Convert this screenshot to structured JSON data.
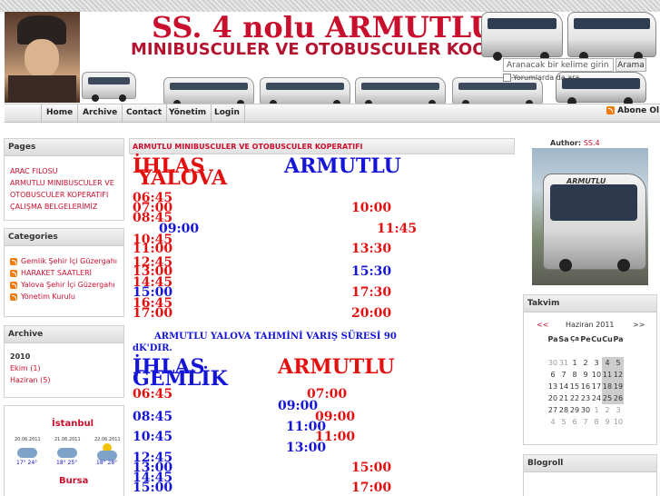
{
  "header": {
    "title": "SS. 4 nolu ARMUTLU",
    "subtitle": "MINIBUSCULER VE OTOBUSCULER  KOOP",
    "search_placeholder": "Aranacak bir kelime girin",
    "search_button": "Arama",
    "search_comments_label": "Yorumlarda da ara"
  },
  "nav": {
    "items": [
      "Home",
      "Archive",
      "Contact",
      "Yönetim",
      "Login"
    ],
    "subscribe": "Abone Ol"
  },
  "sidebar": {
    "pages_title": "Pages",
    "pages": [
      "ARAC FILOSU",
      "ARMUTLU MINIBUSCULER VE OTOBUSCULER KOPERATIFI",
      "ÇALIŞMA BELGELERİMİZ"
    ],
    "categories_title": "Categories",
    "categories": [
      "Gemlik Şehir İçi Güzergahı",
      "HARAKET SAATLERİ",
      "Yalova Şehir İçi Güzergahı",
      "Yönetim Kurulu"
    ],
    "archive_title": "Archive",
    "archive_year": "2010",
    "archive_items": [
      "Ekim (1)",
      "Haziran (5)"
    ],
    "weather_city1": "İstanbul",
    "weather_city2": "Bursa",
    "weather_days": [
      {
        "date": "20.06.2011",
        "temp": "17° 24°",
        "icon": "rain-cloud-icon"
      },
      {
        "date": "21.06.2011",
        "temp": "18° 25°",
        "icon": "rain-cloud-icon"
      },
      {
        "date": "22.06.2011",
        "temp": "18° 28°",
        "icon": "sun-cloud-icon"
      }
    ]
  },
  "post": {
    "title": "ARMUTLU MINIBUSCULER VE OTOBUSCULER KOPERATIFI",
    "yalova": {
      "col1": "İHLAS",
      "col1b": "YALOVA",
      "col2": "ARMUTLU",
      "left_times": [
        "06:45",
        "07:00",
        "08:45"
      ],
      "mid_time": "09:00",
      "left_times2": [
        "10:45",
        "11:00",
        "12:45",
        "13:00",
        "14:45"
      ],
      "left_blue": "15:00",
      "left_times3": [
        "16:45",
        "17:00"
      ],
      "right_times": [
        "10:00",
        "11:45",
        "13:30",
        "15:30",
        "17:30",
        "20:00"
      ],
      "note": "ARMUTLU YALOVA TAHMİNİ VARIŞ SÜRESİ  90 dK'DIR."
    },
    "gemlik": {
      "col1": "İHLAS",
      "col1b": "GEMLİK",
      "col2": "ARMUTLU",
      "left_red": "06:45",
      "right_a": "07:00",
      "mid_a": "09:00",
      "right_b": "09:00",
      "left_b": "08:45",
      "mid_b": "11:00",
      "right_c": "11:00",
      "left_c": "10:45",
      "mid_c": "13:00",
      "left_d": [
        "12:45",
        "13:00",
        "14:45",
        "15:00"
      ],
      "right_d": "15:00",
      "right_e": "17:00"
    }
  },
  "right": {
    "author_label": "Author:",
    "author_name": "SS.4",
    "bus_text": "ARMUTLU",
    "calendar_title": "Takvim",
    "calendar_month": "Haziran 2011",
    "calendar_prev": "<<",
    "calendar_next": ">>",
    "weekdays": [
      "Pa",
      "Sa",
      "Ça",
      "Pe",
      "Cu",
      "Cu",
      "Pa"
    ],
    "weeks": [
      [
        "30",
        "31",
        "1",
        "2",
        "3",
        "4",
        "5"
      ],
      [
        "6",
        "7",
        "8",
        "9",
        "10",
        "11",
        "12"
      ],
      [
        "13",
        "14",
        "15",
        "16",
        "17",
        "18",
        "19"
      ],
      [
        "20",
        "21",
        "22",
        "23",
        "24",
        "25",
        "26"
      ],
      [
        "27",
        "28",
        "29",
        "30",
        "1",
        "2",
        "3"
      ],
      [
        "4",
        "5",
        "6",
        "7",
        "8",
        "9",
        "10"
      ]
    ],
    "blogroll_title": "Blogroll"
  }
}
